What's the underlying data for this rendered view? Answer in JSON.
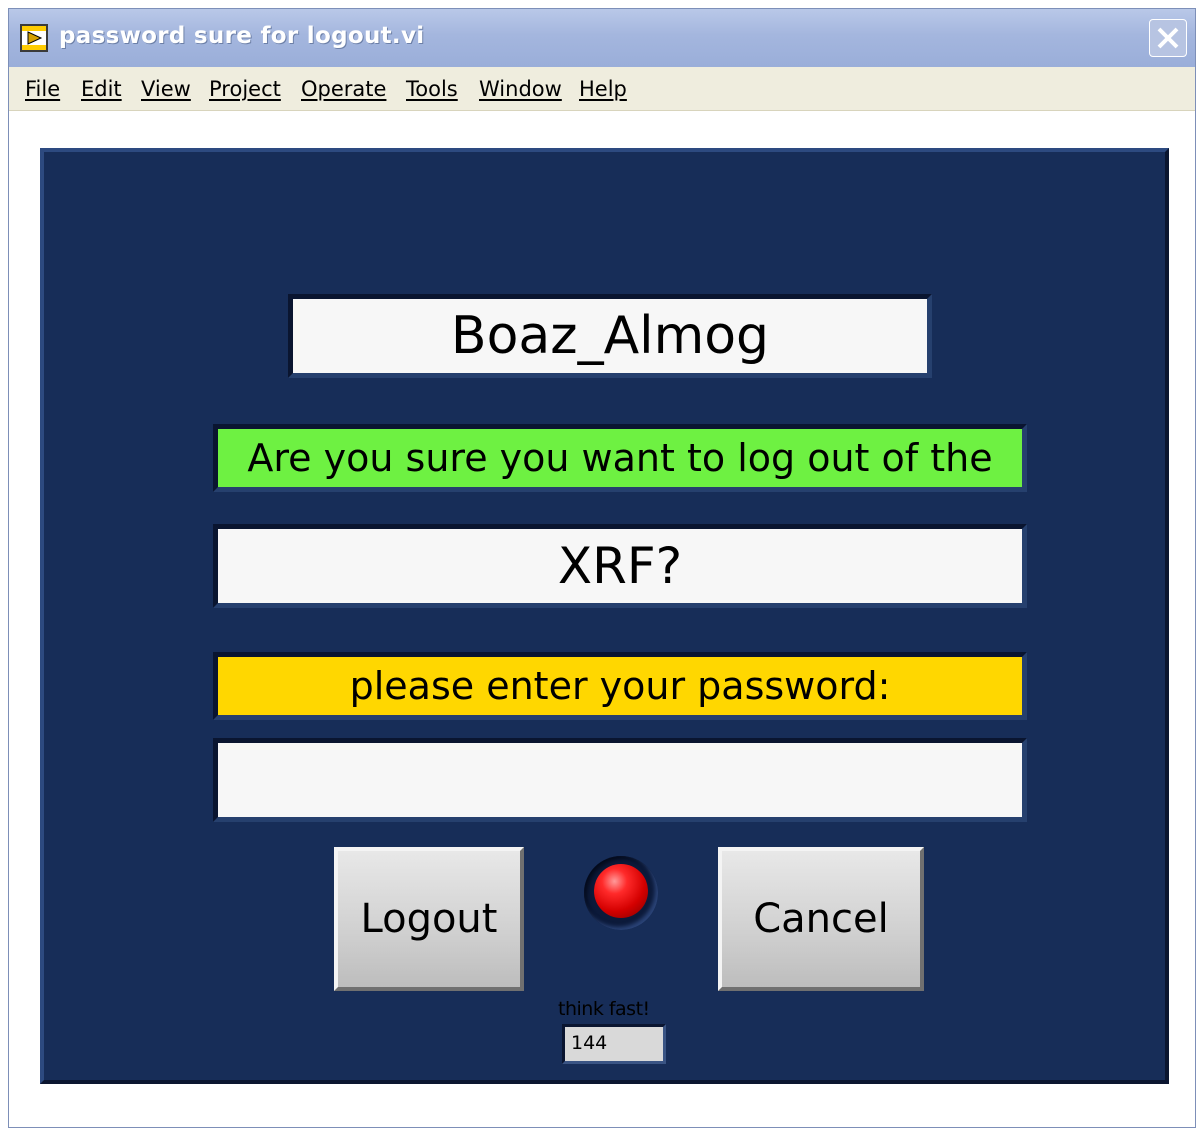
{
  "window": {
    "title": "password sure for logout.vi",
    "close_icon": "close-icon",
    "app_icon": "labview-vi-icon"
  },
  "menubar": {
    "items": [
      "File",
      "Edit",
      "View",
      "Project",
      "Operate",
      "Tools",
      "Window",
      "Help"
    ]
  },
  "panel": {
    "username": "Boaz_Almog",
    "question": "Are you sure you want to log out of the",
    "system": "XRF?",
    "prompt": "please enter your password:",
    "password_value": "",
    "logout_label": "Logout",
    "cancel_label": "Cancel",
    "indicator_color": "#ff0000",
    "timer_label": "think fast!",
    "timer_value": "144"
  },
  "colors": {
    "panel_bg": "#172d58",
    "question_bg": "#6ef142",
    "prompt_bg": "#ffd700"
  }
}
